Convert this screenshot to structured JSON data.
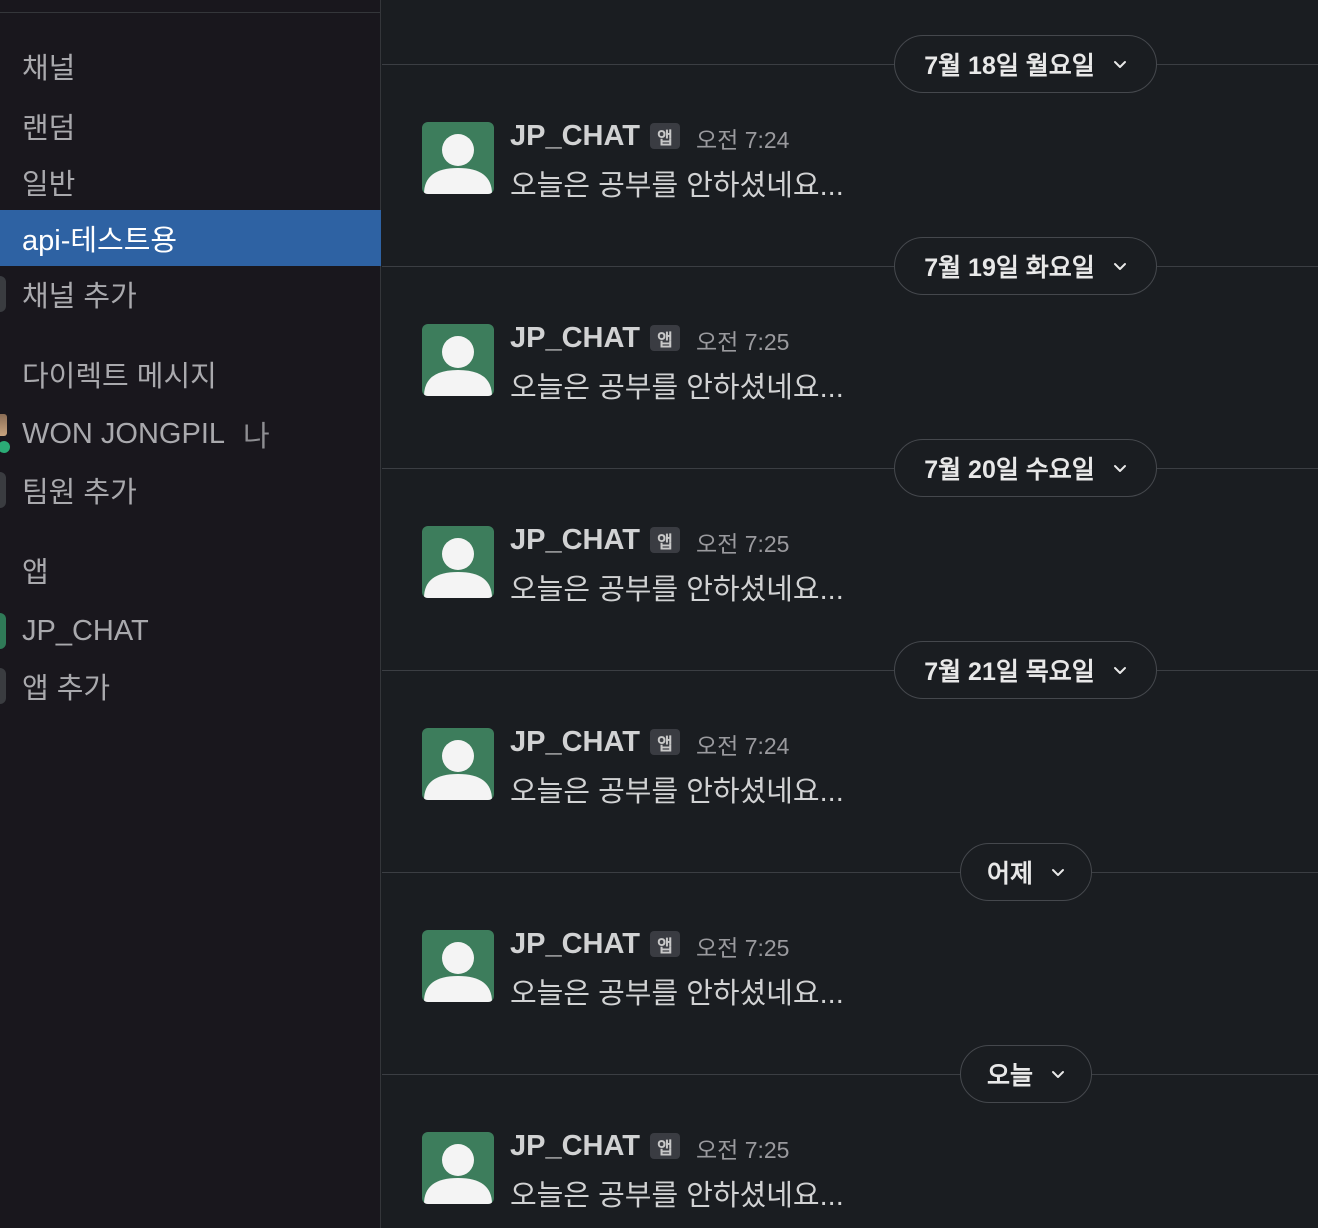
{
  "sidebar": {
    "channels_header": "채널",
    "channels": [
      {
        "label": "랜덤",
        "active": false
      },
      {
        "label": "일반",
        "active": false
      },
      {
        "label": "api-테스트용",
        "active": true
      }
    ],
    "add_channel": "채널 추가",
    "dm_header": "다이렉트 메시지",
    "dm_user": {
      "name": "WON JONGPIL",
      "self_tag": "나"
    },
    "add_teammate": "팀원 추가",
    "apps_header": "앱",
    "app_item": "JP_CHAT",
    "add_app": "앱 추가"
  },
  "colors": {
    "sidebar_bg": "#19171d",
    "active_item": "#2e62a3",
    "main_bg": "#1a1d21",
    "avatar_bg": "#3d7d5c",
    "presence": "#2bac76"
  },
  "messages": {
    "groups": [
      {
        "date": "7월 18일 월요일",
        "sender": "JP_CHAT",
        "badge": "앱",
        "time": "오전 7:24",
        "text": "오늘은 공부를 안하셨네요..."
      },
      {
        "date": "7월 19일 화요일",
        "sender": "JP_CHAT",
        "badge": "앱",
        "time": "오전 7:25",
        "text": "오늘은 공부를 안하셨네요..."
      },
      {
        "date": "7월 20일 수요일",
        "sender": "JP_CHAT",
        "badge": "앱",
        "time": "오전 7:25",
        "text": "오늘은 공부를 안하셨네요..."
      },
      {
        "date": "7월 21일 목요일",
        "sender": "JP_CHAT",
        "badge": "앱",
        "time": "오전 7:24",
        "text": "오늘은 공부를 안하셨네요..."
      },
      {
        "date": "어제",
        "sender": "JP_CHAT",
        "badge": "앱",
        "time": "오전 7:25",
        "text": "오늘은 공부를 안하셨네요..."
      },
      {
        "date": "오늘",
        "sender": "JP_CHAT",
        "badge": "앱",
        "time": "오전 7:25",
        "text": "오늘은 공부를 안하셨네요..."
      }
    ]
  }
}
